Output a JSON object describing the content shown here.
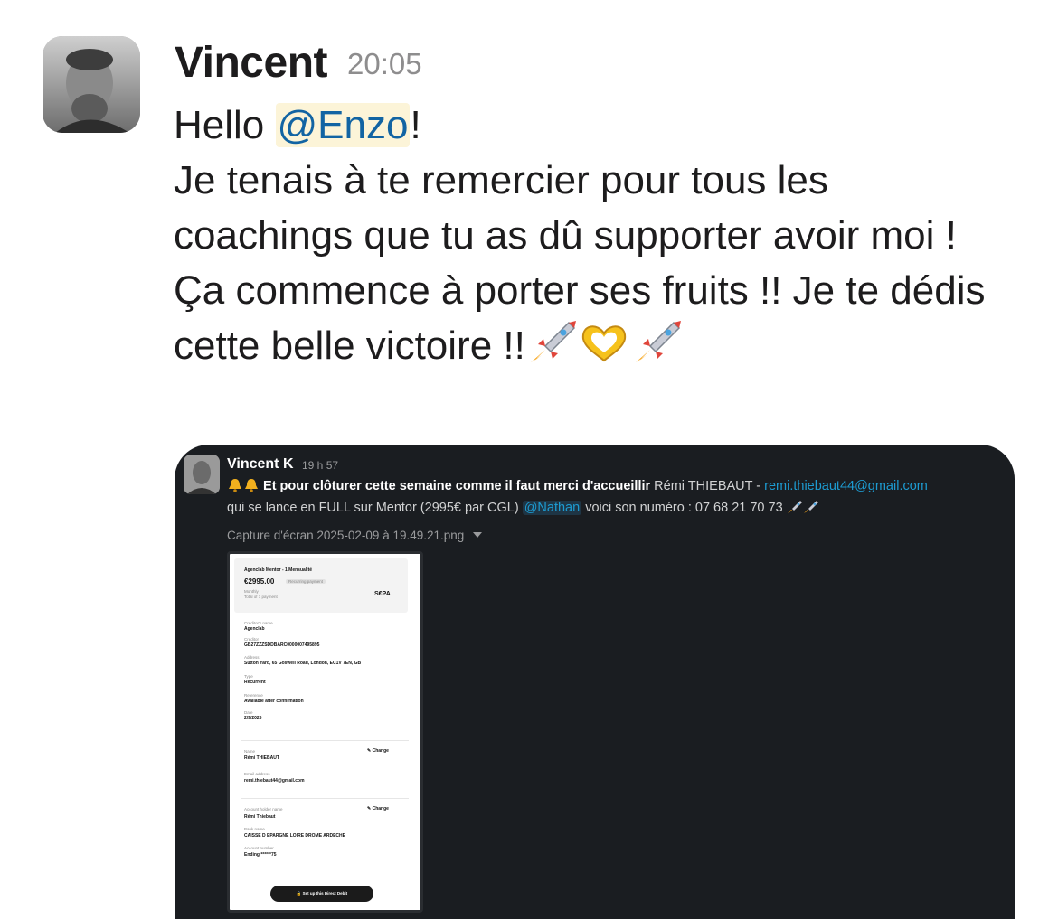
{
  "message": {
    "author": "Vincent",
    "time": "20:05",
    "greeting": "Hello ",
    "mention": "@Enzo",
    "exclaim": "!",
    "line2": "Je tenais à te remercier pour tous les coachings que tu as dû supporter avoir moi !",
    "line3": "Ça commence à porter ses fruits !! Je te dédis cette belle victoire !!",
    "emojis": [
      "rocket-icon",
      "heart-hands-icon",
      "rocket-icon"
    ]
  },
  "screenshot": {
    "author": "Vincent K",
    "time": "19 h 57",
    "line1_bold": "Et pour clôturer cette semaine comme il faut merci d'accueillir",
    "line1_name": " Rémi THIEBAUT - ",
    "line1_email": "remi.thiebaut44@gmail.com",
    "line2_pre": "qui se lance en FULL sur Mentor (2995€ par CGL) ",
    "line2_mention": "@Nathan",
    "line2_post": " voici son numéro : 07 68 21 70 73",
    "file_name": "Capture d'écran 2025-02-09 à 19.49.21.png",
    "thumb": {
      "product": "Agenclab Mentor - 1 Mensualité",
      "amount": "€2995.00",
      "badge": "Recurring payment",
      "period": "Monthly",
      "payments": "Total of 1 payment",
      "sepa": "S€PA",
      "creditor_name_label": "Creditor's name",
      "creditor_name": "Agenclab",
      "creditor_label": "Creditor",
      "creditor": "GB27ZZZSDDBARC0000007495895",
      "address_label": "Address",
      "address": "Sutton Yard, 65 Goswell Road, London, EC1V 7EN, GB",
      "type_label": "Type",
      "type": "Recurrent",
      "reference_label": "Reference",
      "reference": "Available after confirmation",
      "date_label": "Date",
      "date": "2/9/2025",
      "name_label": "Name",
      "name": "Rémi THIEBAUT",
      "change": "✎ Change",
      "email_label": "Email address",
      "email": "remi.thiebaut44@gmail.com",
      "holder_label": "Account holder name",
      "holder": "Rémi Thiebaut",
      "bank_label": "Bank name",
      "bank": "CAISSE D EPARGNE LOIRE DROME ARDECHE",
      "account_label": "Account number",
      "account": "Ending ******75",
      "button": "🔒 Set up this Direct Debit"
    }
  },
  "colors": {
    "mention_text": "#1264a3",
    "mention_bg": "#fcf4d8",
    "dark_bg": "#1a1d21",
    "dark_link": "#1d9bd1"
  }
}
